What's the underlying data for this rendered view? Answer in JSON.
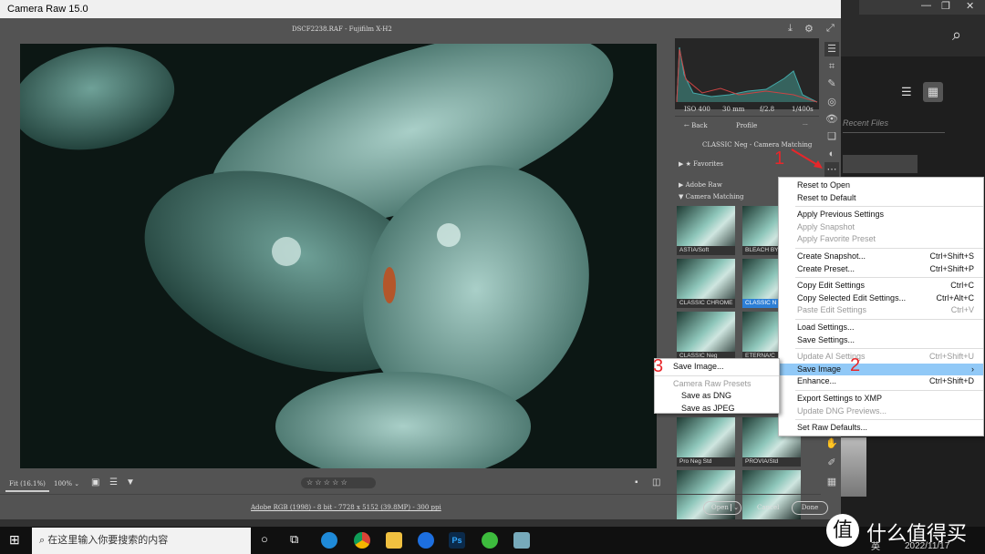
{
  "window": {
    "title": "Camera Raw 15.0"
  },
  "header": {
    "filename": "DSCF2238.RAF  -  Fujifilm X-H2"
  },
  "histogram": {
    "iso": "ISO 400",
    "focal": "30 mm",
    "aperture": "f/2.8",
    "shutter": "1/400s"
  },
  "profile": {
    "back": "Back",
    "title": "Profile",
    "more": "...",
    "current": "CLASSIC Neg - Camera Matching",
    "groups": [
      "Favorites",
      "Adobe Raw",
      "Camera Matching"
    ],
    "thumbs": [
      "ASTIA/Soft",
      "BLEACH BY",
      "CLASSIC CHROME",
      "CLASSIC N",
      "CLASSIC Neg",
      "ETERNA/C",
      "",
      "",
      "Pro Neg Std",
      "PROVIA/Std",
      "",
      ""
    ],
    "selected": "CLASSIC N"
  },
  "bottom": {
    "fit": "Fit (16.1%)",
    "zoom": "100%",
    "stars": "☆ ☆ ☆ ☆ ☆",
    "info": "Adobe RGB (1998) - 8 bit - 7728 x 5152 (39.8MP) - 300 ppi",
    "open": "Open",
    "cancel": "Cancel",
    "done": "Done"
  },
  "menu": [
    {
      "label": "Reset to Open",
      "shortcut": ""
    },
    {
      "label": "Reset to Default",
      "shortcut": ""
    },
    {
      "sep": true
    },
    {
      "label": "Apply Previous Settings",
      "shortcut": ""
    },
    {
      "label": "Apply Snapshot",
      "shortcut": "",
      "disabled": true
    },
    {
      "label": "Apply Favorite Preset",
      "shortcut": "",
      "disabled": true
    },
    {
      "sep": true
    },
    {
      "label": "Create Snapshot...",
      "shortcut": "Ctrl+Shift+S"
    },
    {
      "label": "Create Preset...",
      "shortcut": "Ctrl+Shift+P"
    },
    {
      "sep": true
    },
    {
      "label": "Copy Edit Settings",
      "shortcut": "Ctrl+C"
    },
    {
      "label": "Copy Selected Edit Settings...",
      "shortcut": "Ctrl+Alt+C"
    },
    {
      "label": "Paste Edit Settings",
      "shortcut": "Ctrl+V",
      "disabled": true
    },
    {
      "sep": true
    },
    {
      "label": "Load Settings...",
      "shortcut": ""
    },
    {
      "label": "Save Settings...",
      "shortcut": ""
    },
    {
      "sep": true
    },
    {
      "label": "Update AI Settings",
      "shortcut": "Ctrl+Shift+U",
      "disabled": true
    },
    {
      "label": "Save Image",
      "shortcut": "›",
      "highlight": true
    },
    {
      "label": "Enhance...",
      "shortcut": "Ctrl+Shift+D"
    },
    {
      "sep": true
    },
    {
      "label": "Export Settings to XMP",
      "shortcut": ""
    },
    {
      "label": "Update DNG Previews...",
      "shortcut": "",
      "disabled": true
    },
    {
      "sep": true
    },
    {
      "label": "Set Raw Defaults...",
      "shortcut": ""
    }
  ],
  "submenu": {
    "save_image": "Save Image...",
    "presets_header": "Camera Raw Presets",
    "dng": "Save as DNG",
    "jpeg": "Save as JPEG"
  },
  "annotations": {
    "one": "1",
    "two": "2",
    "three": "3"
  },
  "ps": {
    "recent": "Recent Files"
  },
  "taskbar": {
    "search_placeholder": "在这里输入你要搜索的内容",
    "date": "2022/11/17",
    "lang": "英",
    "watermark": "什么值得买",
    "watermark_badge": "值"
  },
  "colors": {
    "highlight": "#91c9f7",
    "selected_thumb": "#2d7fd6",
    "annotation": "#e8262a"
  }
}
